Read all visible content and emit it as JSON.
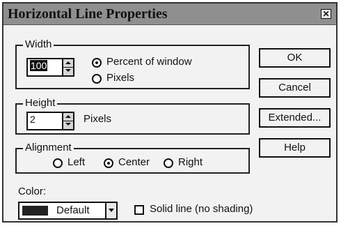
{
  "window": {
    "title": "Horizontal Line Properties"
  },
  "width_group": {
    "legend": "Width",
    "value": "100",
    "options": [
      {
        "label": "Percent of window",
        "selected": true
      },
      {
        "label": "Pixels",
        "selected": false
      }
    ]
  },
  "height_group": {
    "legend": "Height",
    "value": "2",
    "unit_label": "Pixels"
  },
  "alignment_group": {
    "legend": "Alignment",
    "options": [
      {
        "label": "Left",
        "selected": false
      },
      {
        "label": "Center",
        "selected": true
      },
      {
        "label": "Right",
        "selected": false
      }
    ]
  },
  "color": {
    "label": "Color:",
    "selected": "Default",
    "swatch_color": "#222222"
  },
  "solid_line": {
    "label": "Solid line (no shading)",
    "checked": false
  },
  "buttons": {
    "ok": "OK",
    "cancel": "Cancel",
    "extended": "Extended...",
    "help": "Help"
  },
  "theme": {
    "title_bar": "#8f8f8f",
    "dialog_bg": "#f2f2f2"
  }
}
